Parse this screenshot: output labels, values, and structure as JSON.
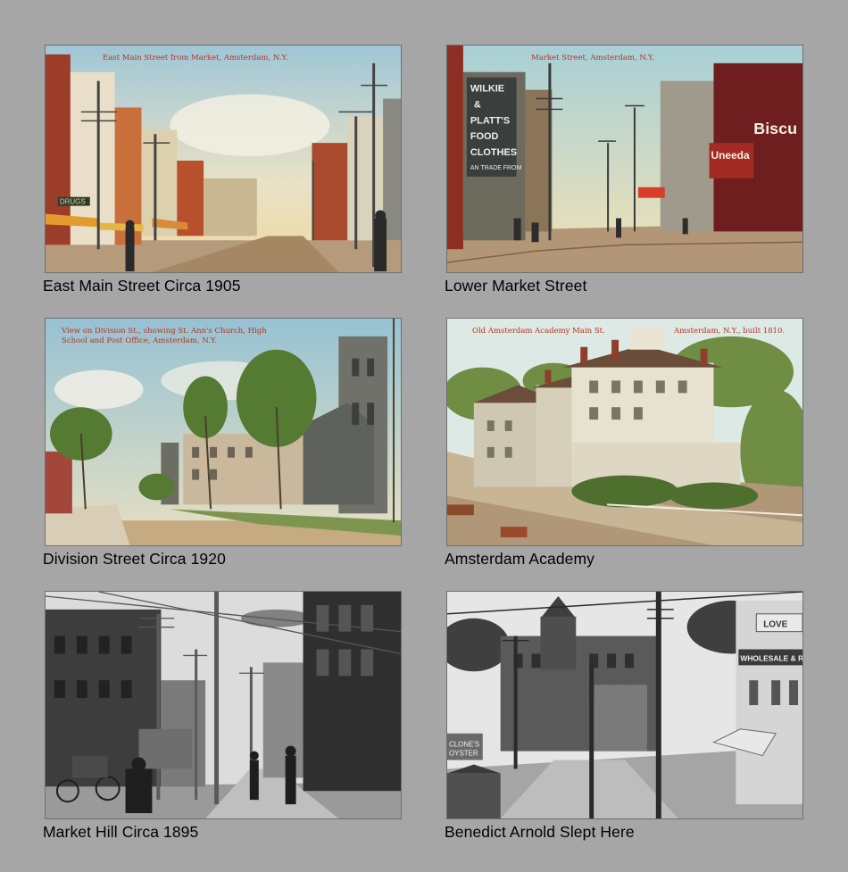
{
  "cards": [
    {
      "caption": "East Main Street Circa 1905",
      "inset_title": "East Main Street from Market, Amsterdam, N.Y.",
      "sign_text": "DRUGS"
    },
    {
      "caption": "Lower Market Street",
      "inset_title": "Market Street, Amsterdam, N.Y.",
      "sign_text": "WILKIE & PLATT'S FOOD CLOTHES ... TRADE FROM COUNTIES",
      "sign2_text": "Uneeda Biscuit"
    },
    {
      "caption": "Division Street Circa 1920",
      "inset_title": "View on Division St., showing St. Ann's Church, High School and Post Office, Amsterdam, N.Y."
    },
    {
      "caption": "Amsterdam Academy",
      "inset_title_left": "Old Amsterdam Academy Main St.",
      "inset_title_right": "Amsterdam, N.Y., built 1810."
    },
    {
      "caption": "Market Hill Circa 1895"
    },
    {
      "caption": "Benedict Arnold Slept Here",
      "sign_text": "WHOLESALE & RETAIL",
      "sign2_text": "LOVE"
    }
  ],
  "colors": {
    "background": "#a6a6a6",
    "inset_title": "#b5341f"
  }
}
